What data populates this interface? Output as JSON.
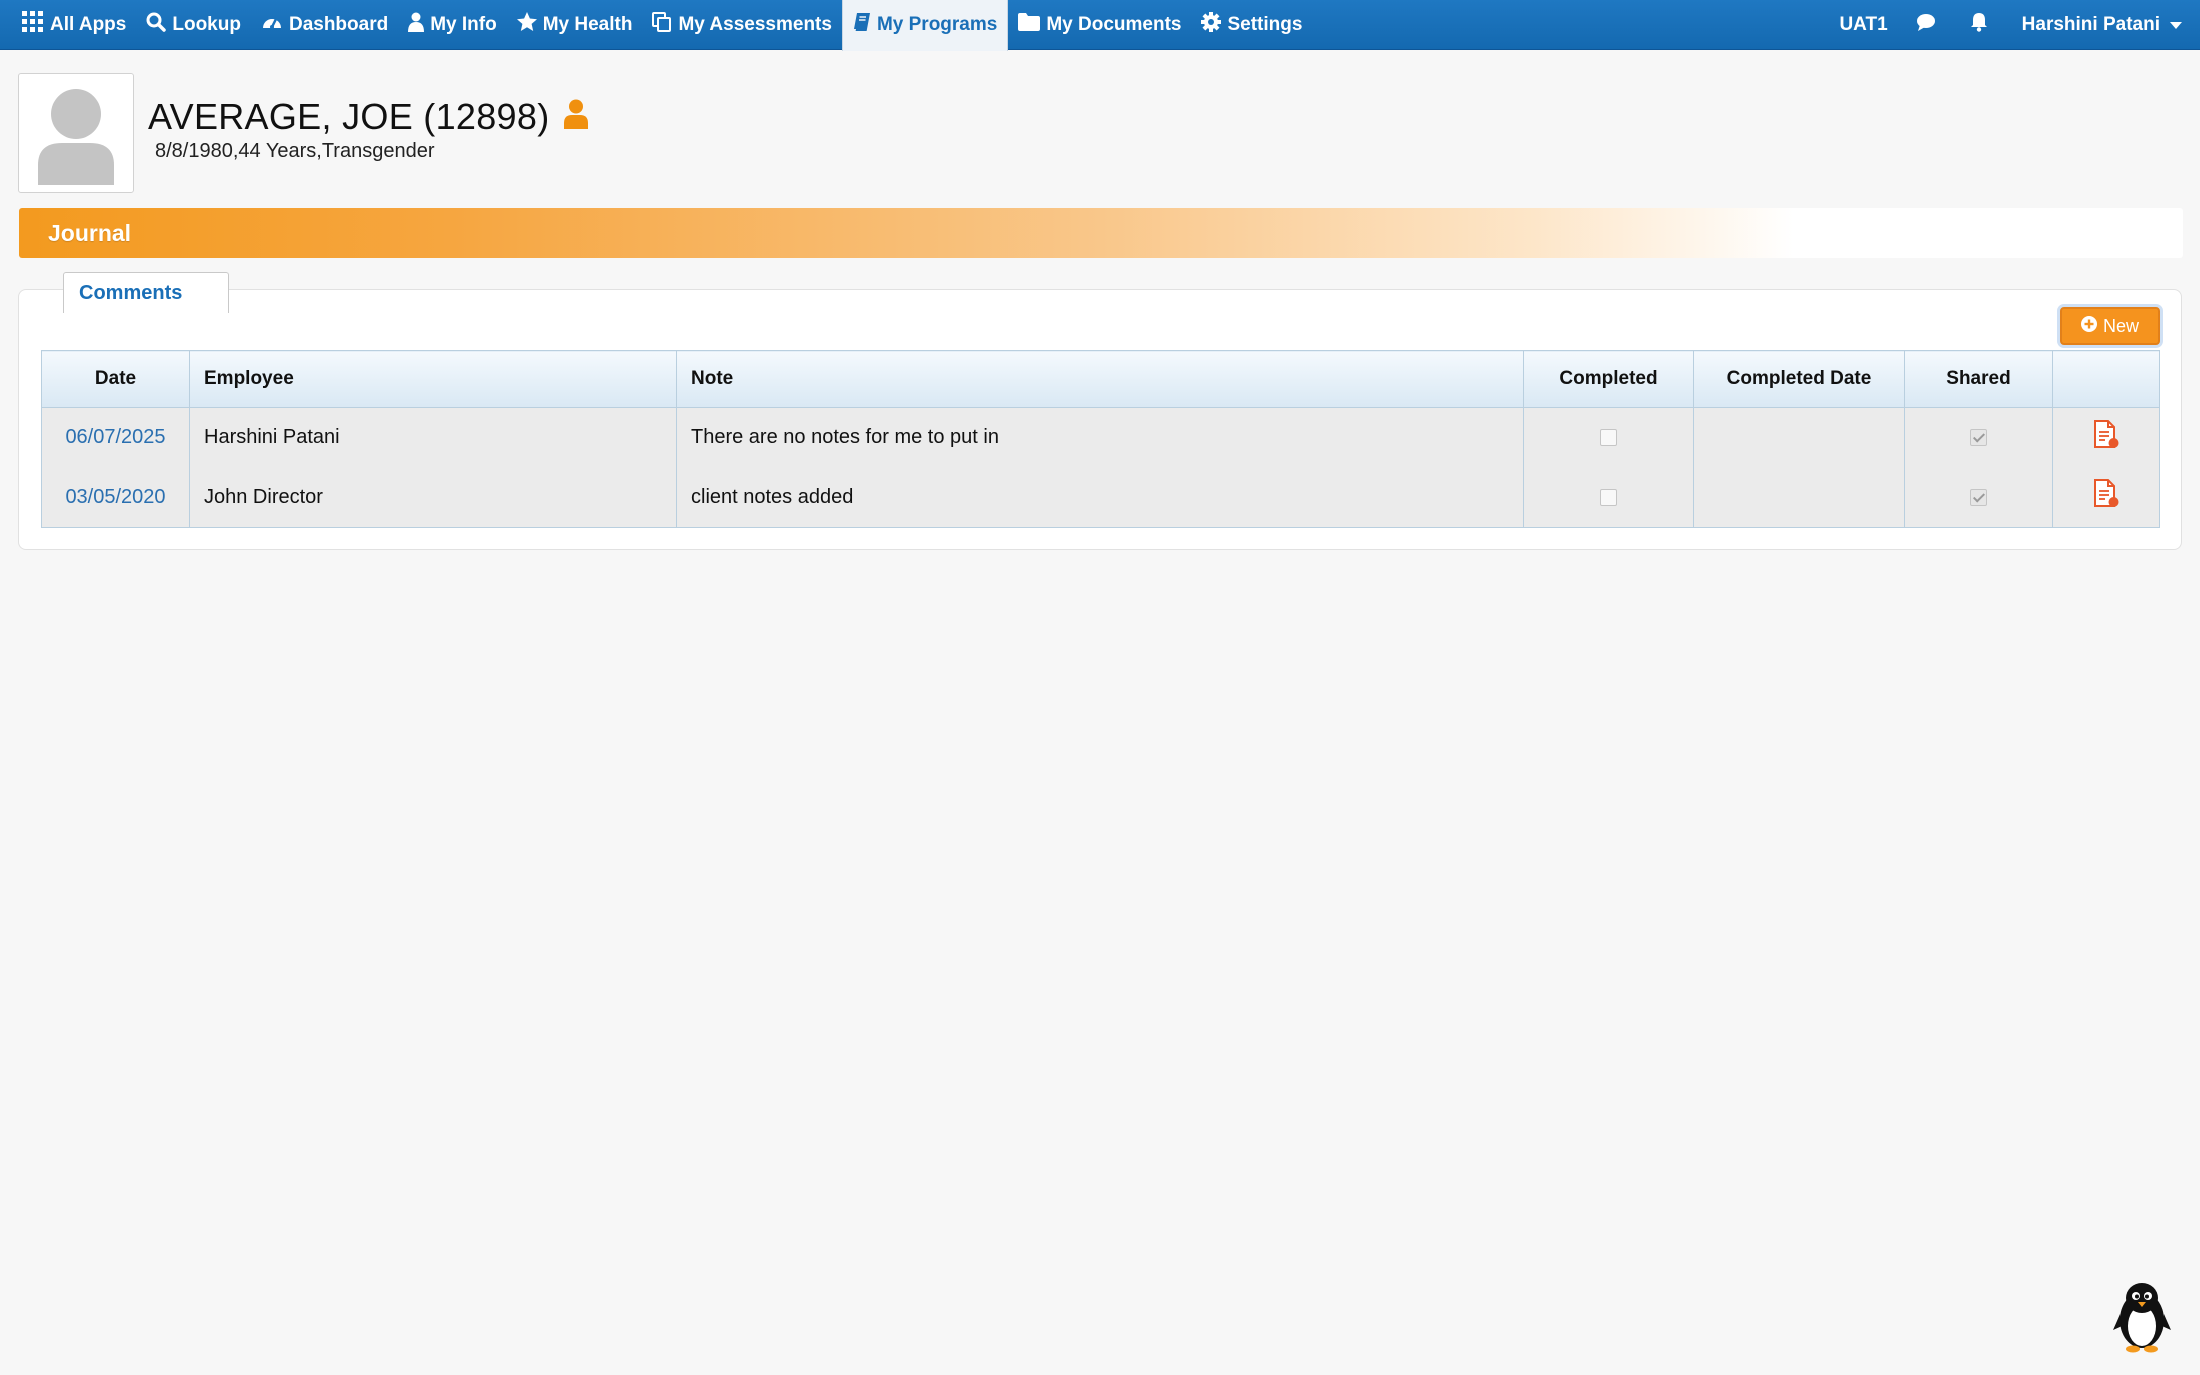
{
  "nav": {
    "items": [
      {
        "label": "All Apps",
        "icon": "grid-icon"
      },
      {
        "label": "Lookup",
        "icon": "search-icon"
      },
      {
        "label": "Dashboard",
        "icon": "dashboard-icon"
      },
      {
        "label": "My Info",
        "icon": "user-icon"
      },
      {
        "label": "My Health",
        "icon": "star-icon"
      },
      {
        "label": "My Assessments",
        "icon": "copy-icon"
      },
      {
        "label": "My Programs",
        "icon": "book-icon",
        "active": true
      },
      {
        "label": "My Documents",
        "icon": "folder-icon"
      },
      {
        "label": "Settings",
        "icon": "gear-icon"
      }
    ],
    "environment": "UAT1",
    "user": "Harshini Patani",
    "chat_icon": "chat-icon",
    "bell_icon": "bell-icon"
  },
  "client": {
    "name": "AVERAGE, JOE (12898)",
    "details": "8/8/1980,44 Years,Transgender"
  },
  "section": {
    "title": "Journal"
  },
  "tab": {
    "label": "Comments"
  },
  "toolbar": {
    "new_label": "New"
  },
  "table": {
    "columns": [
      "Date",
      "Employee",
      "Note",
      "Completed",
      "Completed Date",
      "Shared",
      ""
    ],
    "rows": [
      {
        "date": "06/07/2025",
        "employee": "Harshini Patani",
        "note": "There are no notes for me to put in",
        "completed": false,
        "completed_date": "",
        "shared": true
      },
      {
        "date": "03/05/2020",
        "employee": "John Director",
        "note": "client notes added",
        "completed": false,
        "completed_date": "",
        "shared": true
      }
    ]
  },
  "colors": {
    "nav_bg": "#1a72bc",
    "accent_orange": "#f5931e",
    "link_blue": "#2a6fb0"
  }
}
